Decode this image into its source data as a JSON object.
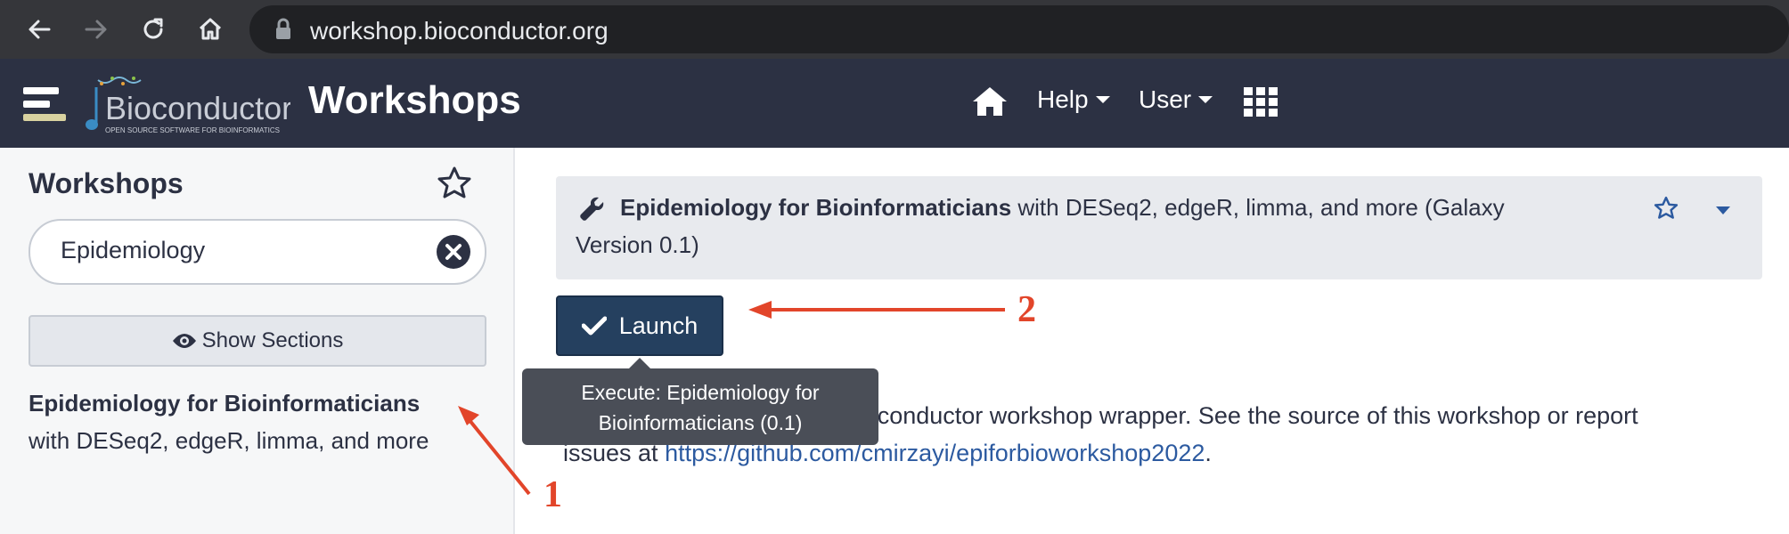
{
  "browser": {
    "url": "workshop.bioconductor.org",
    "icons": [
      "back-arrow-icon",
      "forward-arrow-icon",
      "reload-icon",
      "home-icon",
      "lock-icon"
    ]
  },
  "masthead": {
    "logo_text": "Bioconductor",
    "logo_tagline": "OPEN SOURCE SOFTWARE FOR BIOINFORMATICS",
    "title": "Workshops",
    "nav": {
      "help": "Help",
      "user": "User"
    },
    "icons": [
      "hamburger-icon",
      "home-icon",
      "apps-grid-icon"
    ]
  },
  "left_panel": {
    "heading": "Workshops",
    "search_value": "Epidemiology",
    "show_sections": "Show Sections",
    "tool_title": "Epidemiology for Bioinformaticians",
    "tool_desc": "with DESeq2, edgeR, limma, and more"
  },
  "tool_header": {
    "name": "Epidemiology for Bioinformaticians",
    "desc_line1": " with DESeq2, edgeR, limma, and more (Galaxy",
    "desc_line2": "Version 0.1)"
  },
  "launch_label": "Launch",
  "tooltip": {
    "line1": "Execute: Epidemiology for",
    "line2": "Bioinformaticians (0.1)"
  },
  "help_text": {
    "line1": "This is an auto-generated Bioconductor workshop wrapper. See the source of this workshop or report",
    "line2_prefix": "issues at ",
    "link": "https://github.com/cmirzayi/epiforbioworkshop2022",
    "line2_suffix": "."
  },
  "annotations": {
    "label1": "1",
    "label2": "2",
    "color": "#e2452a"
  },
  "colors": {
    "navbar": "#2c3143",
    "launch": "#25405f",
    "link": "#2c5aa0"
  }
}
